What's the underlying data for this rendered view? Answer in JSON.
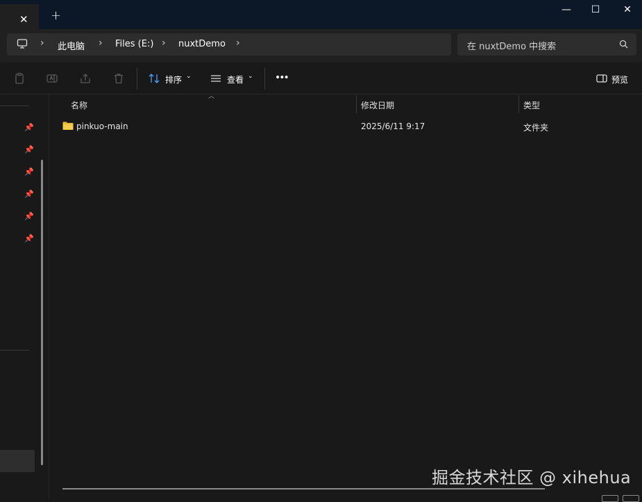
{
  "window": {
    "tab_close_glyph": "✕",
    "new_tab_glyph": "+",
    "minimize": "—",
    "maximize": "☐",
    "close": "✕"
  },
  "breadcrumb": [
    "此电脑",
    "Files (E:)",
    "nuxtDemo"
  ],
  "search": {
    "placeholder": "在 nuxtDemo 中搜索"
  },
  "toolbar": {
    "sort_label": "排序",
    "view_label": "查看",
    "more_label": "•••",
    "preview_label": "预览"
  },
  "columns": {
    "name": "名称",
    "modified": "修改日期",
    "type": "类型"
  },
  "files": [
    {
      "name": "pinkuo-main",
      "modified": "2025/6/11 9:17",
      "type": "文件夹"
    }
  ],
  "watermark": "掘金技术社区 @ xihehua",
  "colors": {
    "accent": "#0c1728",
    "folder": "#e8b83a"
  }
}
